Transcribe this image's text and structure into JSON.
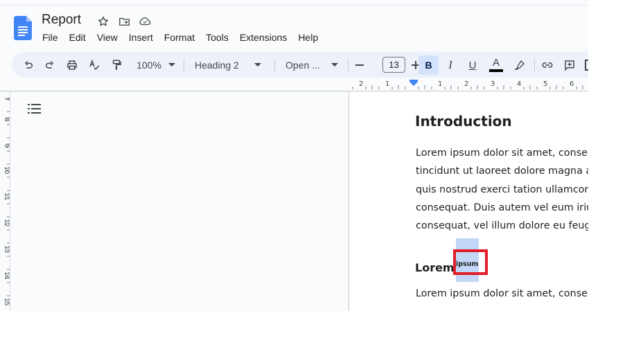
{
  "document": {
    "title": "Report"
  },
  "menu": [
    "File",
    "Edit",
    "View",
    "Insert",
    "Format",
    "Tools",
    "Extensions",
    "Help"
  ],
  "toolbar": {
    "zoom": "100%",
    "style": "Heading 2",
    "font": "Open ...",
    "font_size": "13",
    "bold": "B",
    "italic": "I",
    "underline": "U",
    "text_color_glyph": "A"
  },
  "ruler": {
    "labels": [
      "2",
      "1",
      "1",
      "2",
      "3",
      "4",
      "5",
      "6"
    ]
  },
  "page": {
    "heading1": "Introduction",
    "paragraph_lines": [
      "Lorem ipsum dolor sit amet, consect",
      "tincidunt ut laoreet dolore magna ali",
      "quis nostrud exerci tation ullamcorpe",
      "consequat. Duis autem vel eum iriure",
      "consequat, vel illum dolore eu feugia"
    ],
    "heading2_before": "Lorem",
    "selected_word": "ipsum",
    "paragraph2_first_line": "Lorem ipsum dolor sit amet, consect"
  },
  "colors": {
    "accent": "#0b57d0",
    "selection": "#c2d7f7",
    "highlight_box": "#e21d27",
    "toolbar_bg": "#edf2fa"
  }
}
